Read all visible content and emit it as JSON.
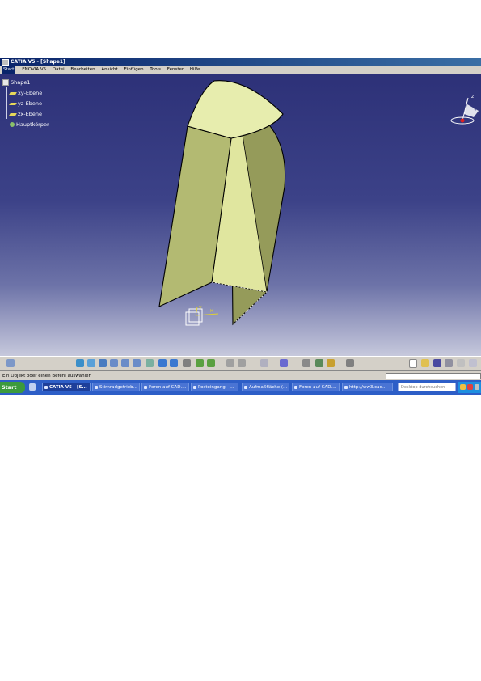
{
  "window": {
    "title": "CATIA V5 - [Shape1]"
  },
  "menu": [
    "Start",
    "ENOVIA V5",
    "Datei",
    "Bearbeiten",
    "Ansicht",
    "Einfügen",
    "Tools",
    "Fenster",
    "Hilfe"
  ],
  "tree": {
    "root": "Shape1",
    "items": [
      "xy-Ebene",
      "yz-Ebene",
      "zx-Ebene",
      "Hauptkörper"
    ]
  },
  "axis": {
    "z": "z",
    "y": "y"
  },
  "compass_labels": {
    "h": "H",
    "v": "V"
  },
  "status": {
    "text": "Ein Objekt oder einen Befehl auswählen",
    "input_value": ""
  },
  "taskbar": {
    "start_label": "Start",
    "tasks": [
      "CATIA V5 - [S...",
      "Stirnradgetrieb...",
      "Foren auf CAD....",
      "Posteingang - ...",
      "Aufmaßfläche (...",
      "Foren auf CAD....",
      "http://ww3.cad..."
    ],
    "search_placeholder": "Desktop durchsuchen"
  },
  "colors": {
    "viewport_top": "#2d3178",
    "viewport_bottom": "#c6c8dc",
    "surface_light": "#e7edae",
    "surface_mid": "#b3ba72",
    "surface_dark": "#959b5a",
    "title_bar": "#0a246a",
    "taskbar": "#2d5ec7"
  }
}
